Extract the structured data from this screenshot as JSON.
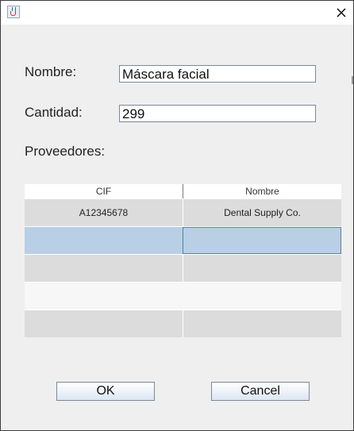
{
  "window": {
    "title": ""
  },
  "form": {
    "nombre_label": "Nombre:",
    "nombre_value": "Máscara facial",
    "cantidad_label": "Cantidad:",
    "cantidad_value": "299",
    "proveedores_label": "Proveedores:"
  },
  "table": {
    "columns": [
      "CIF",
      "Nombre"
    ],
    "rows": [
      [
        "A12345678",
        "Dental Supply Co."
      ],
      [
        "",
        ""
      ],
      [
        "",
        ""
      ],
      [
        "",
        ""
      ],
      [
        "",
        ""
      ]
    ],
    "selected_row": 1
  },
  "buttons": {
    "ok_label": "OK",
    "cancel_label": "Cancel"
  },
  "colors": {
    "selection": "#b8cfe5",
    "selection_border": "#5c7ea8",
    "row_gray": "#dcdcdc",
    "row_light": "#f7f7f7"
  }
}
